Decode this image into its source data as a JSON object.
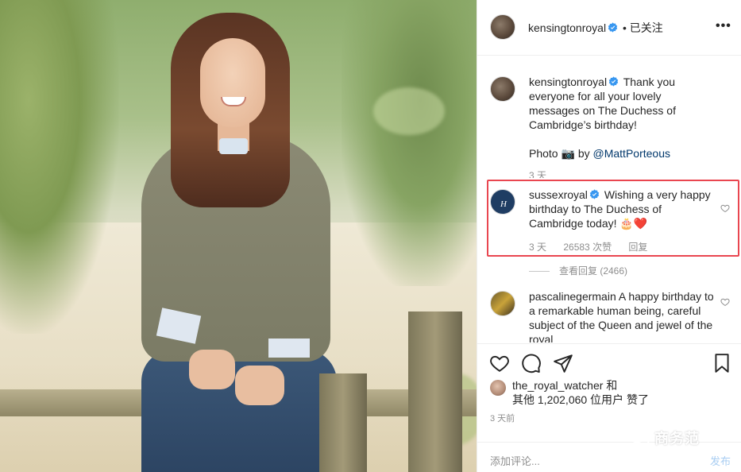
{
  "header": {
    "username": "kensingtonroyal",
    "separator": "•",
    "follow_status": "已关注",
    "more_icon": "more-horizontal-icon"
  },
  "caption": {
    "username": "kensingtonroyal",
    "text": "Thank you everyone for all your lovely messages on The Duchess of Cambridge’s birthday!",
    "photo_prefix": "Photo",
    "photo_by": "by",
    "mention": "@MattPorteous",
    "time": "3 天"
  },
  "comments": [
    {
      "username": "sussexroyal",
      "text": "Wishing a very happy birthday to The Duchess of Cambridge today!",
      "emoji": "🎂❤️",
      "time": "3 天",
      "likes": "26583 次赞",
      "reply": "回复",
      "view_replies": "查看回复 (2466)"
    },
    {
      "username": "pascalinegermain",
      "text": "A happy birthday to a remarkable human being, careful subject of the Queen and jewel of the royal"
    }
  ],
  "likes": {
    "line1_user": "the_royal_watcher",
    "line1_suffix": "和",
    "line2": "其他 1,202,060 位用户 赞了"
  },
  "post_time": "3 天前",
  "add_comment": {
    "placeholder": "添加评论...",
    "post_label": "发布"
  },
  "watermark": {
    "text": "商务范"
  },
  "colors": {
    "verified": "#3897f0",
    "highlight": "#e94650",
    "link": "#00376b"
  }
}
